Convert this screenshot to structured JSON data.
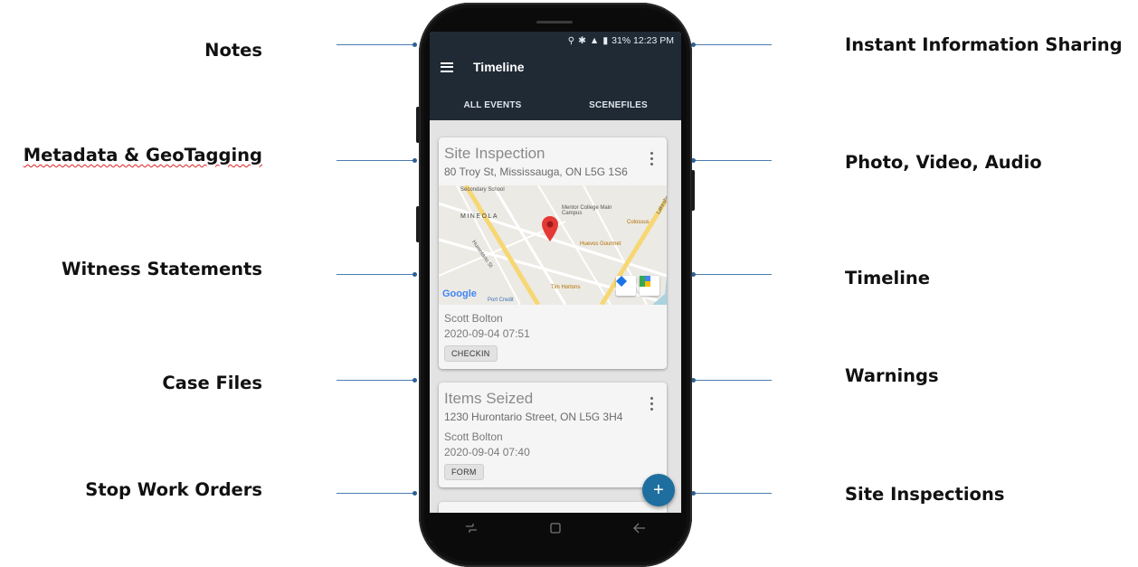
{
  "left_labels": [
    "Notes",
    "Metadata & GeoTagging",
    "Witness Statements",
    "Case Files",
    "Stop Work Orders"
  ],
  "right_labels": [
    "Instant Information Sharing",
    "Photo, Video, Audio",
    "Timeline",
    "Warnings",
    "Site Inspections"
  ],
  "status": {
    "text": "31% 12:23 PM"
  },
  "appbar": {
    "title": "Timeline"
  },
  "tabs": [
    {
      "label": "ALL EVENTS"
    },
    {
      "label": "SCENEFILES"
    }
  ],
  "cards": [
    {
      "title": "Site Inspection",
      "address": "80 Troy St, Mississauga, ON L5G 1S6",
      "person": "Scott Bolton",
      "date": "2020-09-04 07:51",
      "chip": "CHECKIN"
    },
    {
      "title": "Items Seized",
      "address": "1230 Hurontario Street, ON L5G 3H4",
      "person": "Scott Bolton",
      "date": "2020-09-04 07:40",
      "chip": "FORM"
    }
  ],
  "map": {
    "labels": [
      "Secondary School",
      "MINEOLA",
      "Mentor College Main Campus",
      "Colossus",
      "Huevos Gourmet",
      "Tim Hortons",
      "Port Credit",
      "Hurontario St",
      "Lakeshore"
    ],
    "google": "Google"
  },
  "fab": {
    "label": "+"
  },
  "colors": {
    "appbar": "#1f2a35",
    "fab": "#1e6f9f",
    "connector": "#4a7cb0"
  }
}
